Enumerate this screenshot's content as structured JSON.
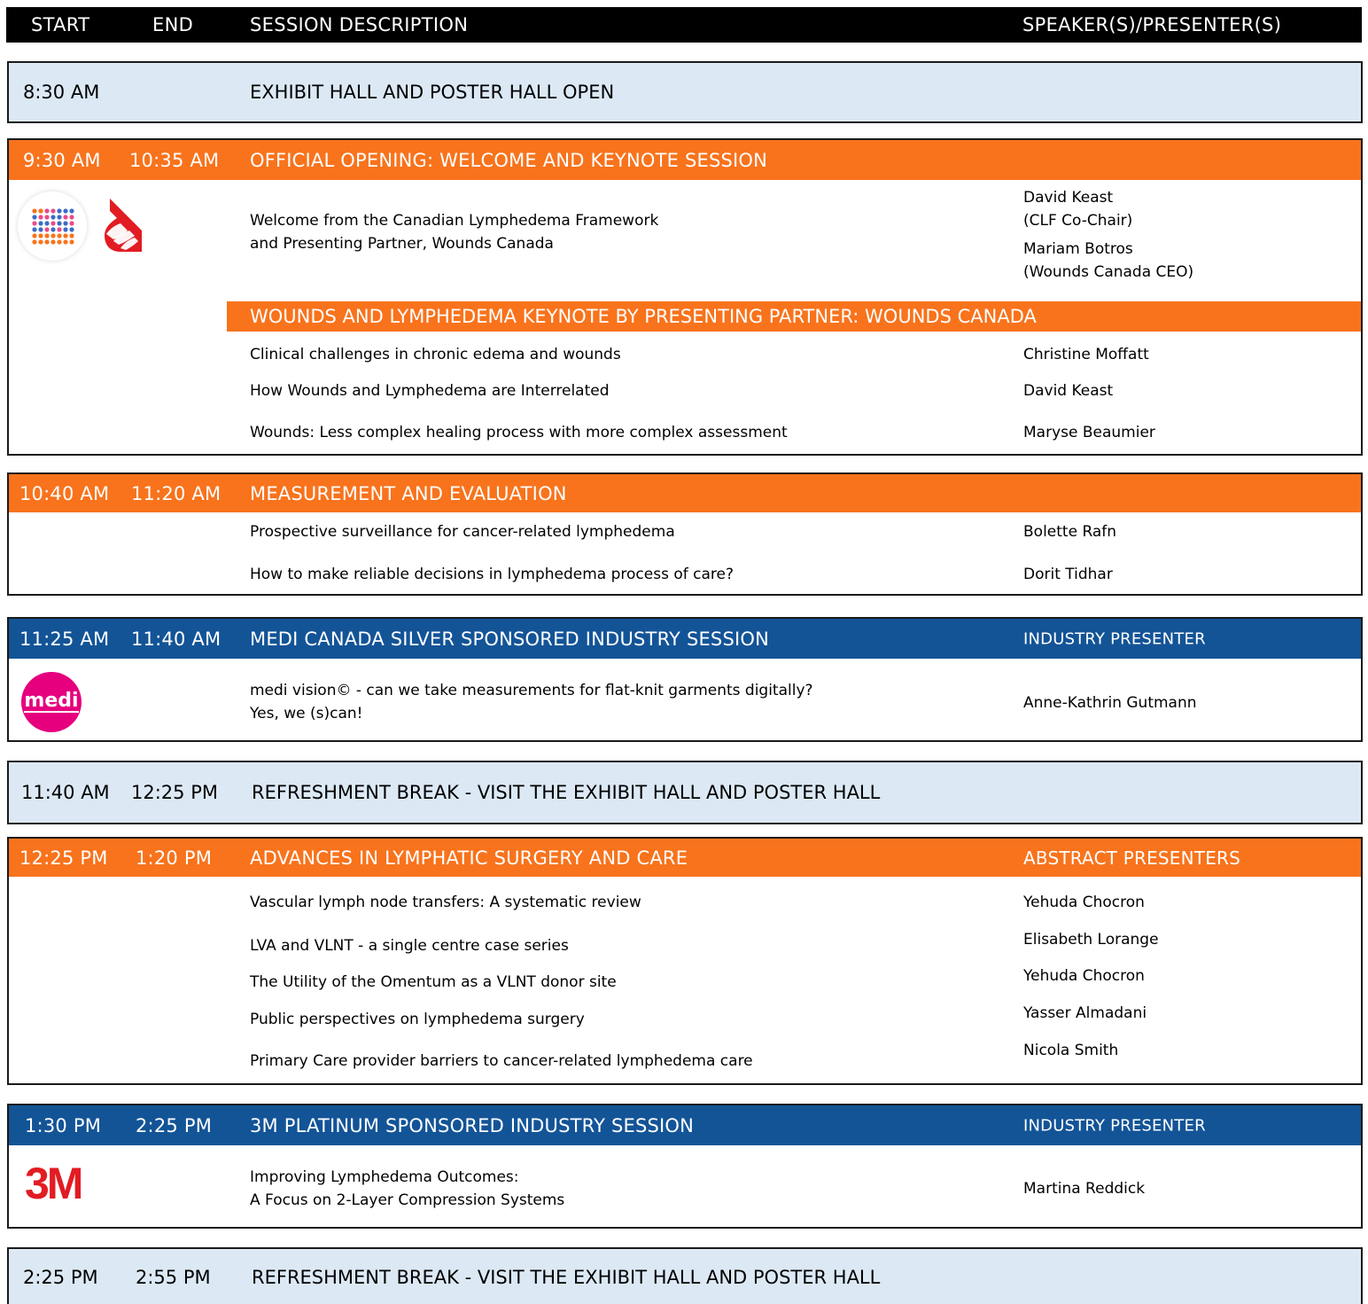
{
  "header": {
    "start": "START",
    "end": "END",
    "description": "SESSION DESCRIPTION",
    "speakers": "SPEAKER(S)/PRESENTER(S)"
  },
  "colors": {
    "orange": "#f8731c",
    "blue": "#135497",
    "light_blue": "#dce9f5",
    "black": "#000000",
    "medi_pink": "#e6007e",
    "red_3m": "#e21c23"
  },
  "blocks": {
    "b1": {
      "start": "8:30 AM",
      "title": "EXHIBIT HALL AND POSTER HALL OPEN"
    },
    "b2": {
      "start": "9:30 AM",
      "end": "10:35 AM",
      "title": "OFFICIAL OPENING: WELCOME AND KEYNOTE SESSION",
      "welcome_line1": "Welcome from the Canadian Lymphedema Framework",
      "welcome_line2": "and Presenting Partner, Wounds Canada",
      "spk1_name": "David Keast",
      "spk1_role": "(CLF Co-Chair)",
      "spk2_name": "Mariam Botros",
      "spk2_role": "(Wounds Canada CEO)",
      "subtitle": "WOUNDS AND LYMPHEDEMA KEYNOTE BY PRESENTING PARTNER: WOUNDS CANADA",
      "talks": [
        {
          "title": "Clinical challenges in chronic edema and wounds",
          "speaker": "Christine Moffatt"
        },
        {
          "title": "How Wounds and Lymphedema are Interrelated",
          "speaker": "David Keast"
        },
        {
          "title": "Wounds: Less complex healing process with more complex assessment",
          "speaker": "Maryse Beaumier"
        }
      ],
      "logos": [
        "clf-logo-icon",
        "wounds-canada-logo-icon"
      ]
    },
    "b3": {
      "start": "10:40 AM",
      "end": "11:20 AM",
      "title": "MEASUREMENT AND EVALUATION",
      "talks": [
        {
          "title": "Prospective surveillance for cancer-related lymphedema",
          "speaker": "Bolette Rafn"
        },
        {
          "title": "How to make reliable decisions in lymphedema process of care?",
          "speaker": "Dorit Tidhar"
        }
      ]
    },
    "b4": {
      "start": "11:25 AM",
      "end": "11:40 AM",
      "title": "MEDI CANADA SILVER SPONSORED INDUSTRY SESSION",
      "presenter_label": "INDUSTRY PRESENTER",
      "talk_line1": "medi vision© - can we take measurements for flat-knit garments digitally?",
      "talk_line2": "Yes, we (s)can!",
      "speaker": "Anne-Kathrin Gutmann",
      "logo_text": "medi"
    },
    "b5": {
      "start": "11:40 AM",
      "end": "12:25 PM",
      "title": "REFRESHMENT BREAK - VISIT THE EXHIBIT HALL AND POSTER HALL"
    },
    "b6": {
      "start": "12:25 PM",
      "end": "1:20 PM",
      "title": "ADVANCES IN LYMPHATIC SURGERY AND CARE",
      "presenter_label": "ABSTRACT PRESENTERS",
      "talks": [
        "Vascular lymph node transfers: A systematic review",
        "LVA and VLNT - a single centre case series",
        "The Utility of the Omentum as a VLNT donor site",
        "Public perspectives on lymphedema surgery",
        "Primary Care provider barriers to cancer-related lymphedema care"
      ],
      "speakers": [
        "Yehuda Chocron",
        "Elisabeth Lorange",
        "Yehuda Chocron",
        "Yasser Almadani",
        "Nicola Smith"
      ]
    },
    "b7": {
      "start": "1:30 PM",
      "end": "2:25 PM",
      "title": "3M PLATINUM SPONSORED INDUSTRY SESSION",
      "presenter_label": "INDUSTRY PRESENTER",
      "talk_line1": "Improving Lymphedema Outcomes:",
      "talk_line2": "A Focus on 2-Layer Compression Systems",
      "speaker": "Martina Reddick",
      "logo_text": "3M"
    },
    "b8": {
      "start": "2:25 PM",
      "end": "2:55 PM",
      "title": "REFRESHMENT BREAK - VISIT THE EXHIBIT HALL AND POSTER HALL"
    }
  }
}
